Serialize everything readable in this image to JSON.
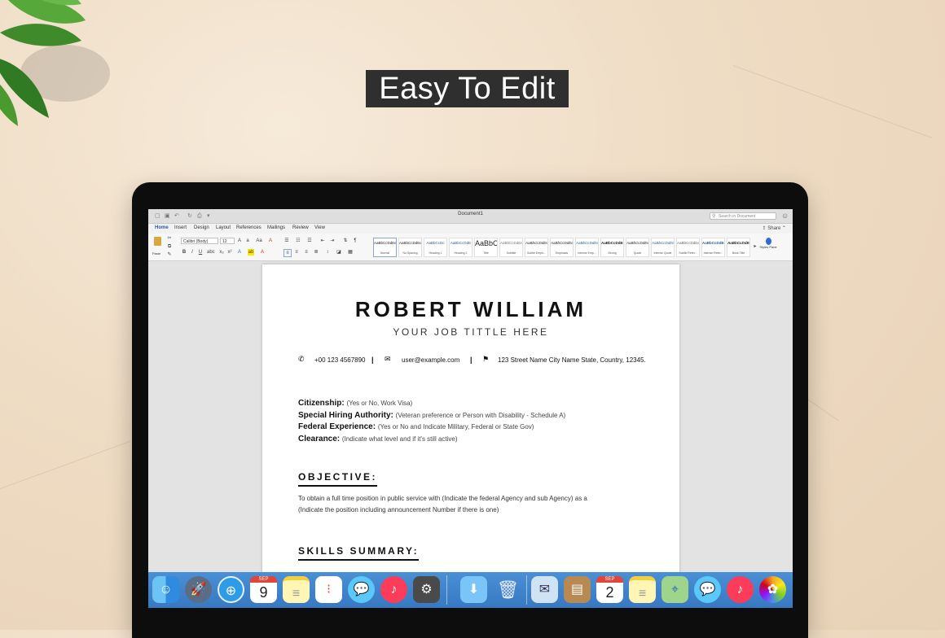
{
  "banner": {
    "text": "Easy To Edit"
  },
  "window": {
    "title": "Document1",
    "search_placeholder": "Search in Document",
    "share_label": "Share"
  },
  "ribbon": {
    "tabs": [
      "Home",
      "Insert",
      "Design",
      "Layout",
      "References",
      "Mailings",
      "Review",
      "View"
    ],
    "active_tab": "Home",
    "paste_label": "Paste",
    "font_name": "Calibri (Body)",
    "font_size": "12",
    "styles": [
      {
        "sample": "AaBbCcDdEe",
        "name": "Normal"
      },
      {
        "sample": "AaBbCcDdEe",
        "name": "No Spacing"
      },
      {
        "sample": "AaBbCcDc",
        "name": "Heading 1"
      },
      {
        "sample": "AaBbCcDdE",
        "name": "Heading 2"
      },
      {
        "sample": "AaBbC",
        "name": "Title"
      },
      {
        "sample": "AaBbCcDdEe",
        "name": "Subtitle"
      },
      {
        "sample": "AaBbCcDdEe",
        "name": "Subtle Emph..."
      },
      {
        "sample": "AaBbCcDdEe",
        "name": "Emphasis"
      },
      {
        "sample": "AaBbCcDdEe",
        "name": "Intense Emp..."
      },
      {
        "sample": "AaBbCcDdEe",
        "name": "Strong"
      },
      {
        "sample": "AaBbCcDdEe",
        "name": "Quote"
      },
      {
        "sample": "AaBbCcDdEe",
        "name": "Intense Quote"
      },
      {
        "sample": "AaBbCcDdEe",
        "name": "Subtle Refer..."
      },
      {
        "sample": "AaBbCcDdEe",
        "name": "Intense Refer..."
      },
      {
        "sample": "AaBbCcDdEe",
        "name": "Book Title"
      }
    ],
    "styles_pane_label": "Styles Pane"
  },
  "resume": {
    "name": "ROBERT WILLIAM",
    "job_title": "YOUR JOB TITTLE HERE",
    "phone": "+00 123 4567890",
    "email": "user@example.com",
    "address": "123 Street Name City Name State, Country, 12345.",
    "info": [
      {
        "label": "Citizenship:",
        "value": "(Yes or No, Work Visa)"
      },
      {
        "label": "Special Hiring Authority:",
        "value": "(Veteran preference or Person with Disability - Schedule A)"
      },
      {
        "label": "Federal Experience:",
        "value": "(Yes or No and Indicate Military, Federal or State Gov)"
      },
      {
        "label": "Clearance:",
        "value": "(Indicate what level and if it's still active)"
      }
    ],
    "objective_heading": "OBJECTIVE:",
    "objective_line1": "To obtain a full time position in public service with (Indicate the federal Agency and sub Agency) as a",
    "objective_line2": "(Indicate the position including announcement Number if there is one)",
    "skills_heading": "SKILLS SUMMARY:"
  },
  "dock": {
    "calendar_left": {
      "month": "SEP",
      "day": "9"
    },
    "calendar_right": {
      "month": "SEP",
      "day": "2"
    }
  }
}
